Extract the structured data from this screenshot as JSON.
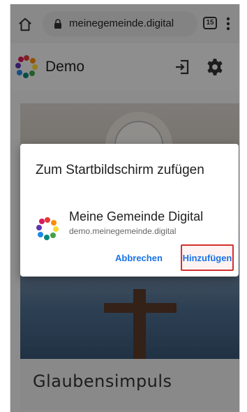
{
  "browser": {
    "url": "meinegemeinde.digital",
    "tab_count": "15",
    "icons": [
      "home-icon",
      "lock-icon",
      "tabs-icon",
      "overflow-menu-icon"
    ]
  },
  "app_header": {
    "title": "Demo",
    "icons": [
      "logo-icon",
      "exit-icon",
      "settings-icon"
    ]
  },
  "card": {
    "title": "Glaubensimpuls"
  },
  "dialog": {
    "title": "Zum Startbildschirm zufügen",
    "app_name": "Meine Gemeinde Digital",
    "app_url": "demo.meinegemeinde.digital",
    "cancel_label": "Abbrechen",
    "add_label": "Hinzufügen"
  },
  "colors": {
    "accent": "#1a73e8",
    "highlight_border": "#d32f2f"
  }
}
